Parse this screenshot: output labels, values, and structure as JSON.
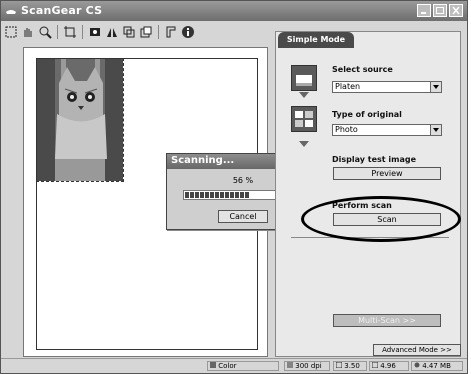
{
  "window": {
    "title": "ScanGear CS"
  },
  "toolbar": {
    "icons": [
      "select-area-icon",
      "pan-icon",
      "zoom-icon",
      "crop-icon",
      "rotate-icon",
      "mirror-icon",
      "fit-icon",
      "copy-icon",
      "settings-icon",
      "info-icon"
    ]
  },
  "progress_dialog": {
    "title": "Scanning...",
    "percent_text": "56 %",
    "progress": 0.56,
    "cancel_label": "Cancel"
  },
  "panel": {
    "tab_label": "Simple Mode",
    "select_source": {
      "label": "Select source",
      "value": "Platen"
    },
    "type_of_original": {
      "label": "Type of original",
      "value": "Photo"
    },
    "display_test_image": {
      "label": "Display test image",
      "button": "Preview"
    },
    "perform_scan": {
      "label": "Perform scan",
      "button": "Scan"
    },
    "multi_scan_button": "Multi-Scan >>",
    "advanced_mode_button": "Advanced Mode >>"
  },
  "status": {
    "color_mode": "Color",
    "resolution": "300 dpi",
    "width": "3.50",
    "height": "4.96",
    "size": "4.47 MB"
  },
  "colors": {
    "titlebar": "#7a7a7a",
    "tab": "#4a4a4a",
    "progress": "#444444"
  }
}
